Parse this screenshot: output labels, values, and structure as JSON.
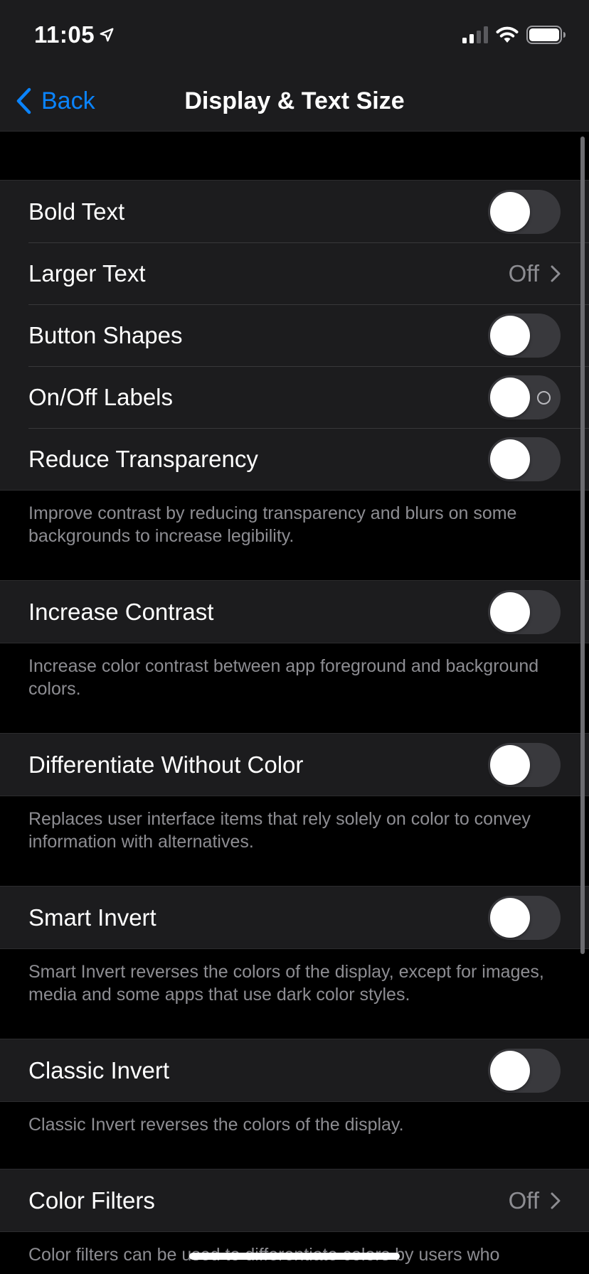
{
  "status": {
    "time": "11:05",
    "icons": [
      "location-arrow-icon",
      "cellular-signal-icon",
      "wifi-icon",
      "battery-icon"
    ]
  },
  "nav": {
    "back_label": "Back",
    "title": "Display & Text Size",
    "accent_color": "#0a84ff"
  },
  "rows": {
    "bold_text": "Bold Text",
    "larger_text": "Larger Text",
    "larger_text_value": "Off",
    "button_shapes": "Button Shapes",
    "onoff_labels": "On/Off Labels",
    "reduce_transparency": "Reduce Transparency",
    "increase_contrast": "Increase Contrast",
    "differentiate": "Differentiate Without Color",
    "smart_invert": "Smart Invert",
    "classic_invert": "Classic Invert",
    "color_filters": "Color Filters",
    "color_filters_value": "Off"
  },
  "toggles": {
    "bold_text": false,
    "button_shapes": false,
    "onoff_labels": false,
    "reduce_transparency": false,
    "increase_contrast": false,
    "differentiate": false,
    "smart_invert": false,
    "classic_invert": false
  },
  "footers": {
    "reduce_transparency": "Improve contrast by reducing transparency and blurs on some backgrounds to increase legibility.",
    "increase_contrast": "Increase color contrast between app foreground and background colors.",
    "differentiate": "Replaces user interface items that rely solely on color to convey information with alternatives.",
    "smart_invert": "Smart Invert reverses the colors of the display, except for images, media and some apps that use dark color styles.",
    "classic_invert": "Classic Invert reverses the colors of the display.",
    "color_filters": "Color filters can be used to differentiate colors by users who"
  }
}
